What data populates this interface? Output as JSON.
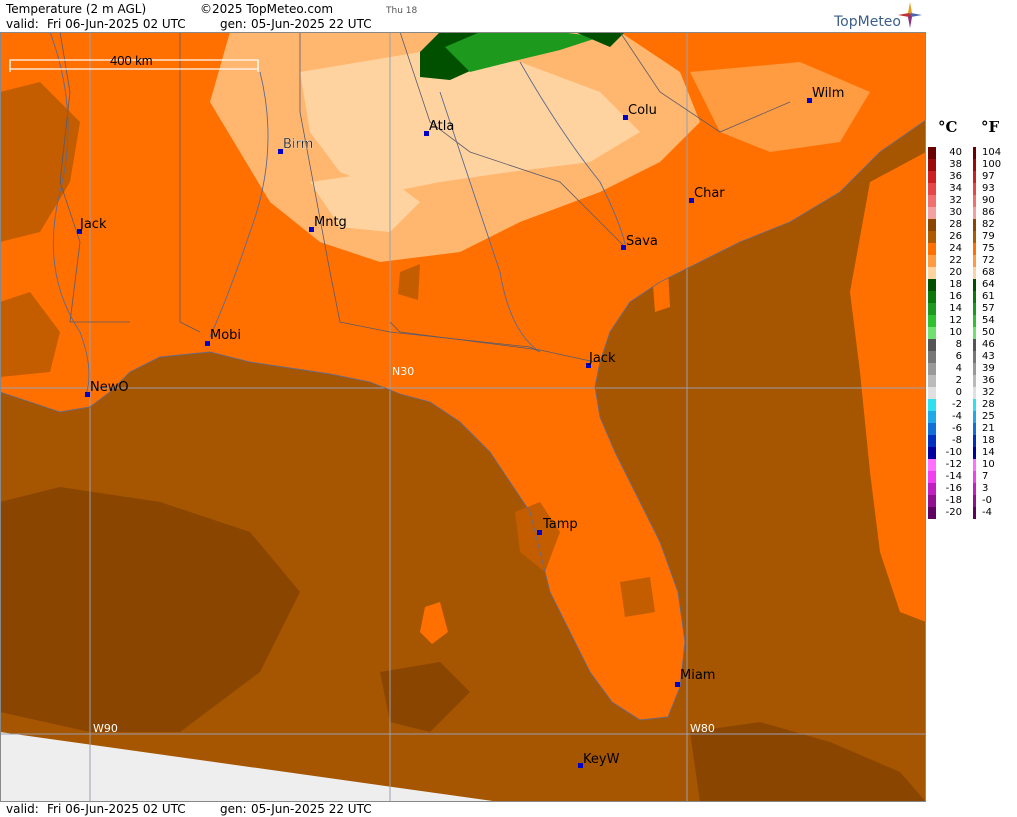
{
  "header": {
    "title": "Temperature (2 m AGL)",
    "copyright": "©2025 TopMeteo.com",
    "valid_label": "valid:",
    "valid_value": "Fri   06-Jun-2025   02 UTC",
    "gen_label": "gen:",
    "gen_value": "05-Jun-2025 22 UTC",
    "day_small": "Thu 18"
  },
  "footer": {
    "valid_label": "valid:",
    "valid_value": "Fri   06-Jun-2025   02 UTC",
    "gen_label": "gen:",
    "gen_value": "05-Jun-2025 22 UTC"
  },
  "logo": {
    "text": "TopMeteo",
    "icon": "compass-star-icon"
  },
  "map": {
    "scale_label": "400 km",
    "grid_labels": {
      "lat": "N30",
      "lon_west": "W90",
      "lon_east": "W80"
    },
    "colors": {
      "sea": "#a65500",
      "land_main": "#ff7000",
      "land_warm_dark": "#c45c00",
      "land_light": "#ffb770",
      "land_pale": "#ffd3a0",
      "green_dark": "#005000",
      "green_mid": "#1d9a1d",
      "sea_dark_patch": "#8a4600",
      "nodata": "#eeeeee",
      "boundary": "#5a5a6a",
      "grid": "#9aa0b0",
      "city_marker": "#0000c8"
    },
    "cities": [
      {
        "name": "Birm"
      },
      {
        "name": "Atla"
      },
      {
        "name": "Colu"
      },
      {
        "name": "Wilm"
      },
      {
        "name": "Jack"
      },
      {
        "name": "Mntg"
      },
      {
        "name": "Char"
      },
      {
        "name": "Sava"
      },
      {
        "name": "Mobi"
      },
      {
        "name": "Jack"
      },
      {
        "name": "NewO"
      },
      {
        "name": "Tamp"
      },
      {
        "name": "Miam"
      },
      {
        "name": "KeyW"
      }
    ]
  },
  "legend": {
    "celsius_unit": "°C",
    "fahrenheit_unit": "°F",
    "entries": [
      {
        "c": "40",
        "f": "104",
        "color": "#6a0000"
      },
      {
        "c": "38",
        "f": "100",
        "color": "#9b0a0a"
      },
      {
        "c": "36",
        "f": "97",
        "color": "#cc2020"
      },
      {
        "c": "34",
        "f": "93",
        "color": "#e64646"
      },
      {
        "c": "32",
        "f": "90",
        "color": "#f07070"
      },
      {
        "c": "30",
        "f": "86",
        "color": "#f5a0a0"
      },
      {
        "c": "28",
        "f": "82",
        "color": "#8a4600"
      },
      {
        "c": "26",
        "f": "79",
        "color": "#b05a00"
      },
      {
        "c": "24",
        "f": "75",
        "color": "#ff7000"
      },
      {
        "c": "22",
        "f": "72",
        "color": "#ff9b40"
      },
      {
        "c": "20",
        "f": "68",
        "color": "#ffd3a0"
      },
      {
        "c": "18",
        "f": "64",
        "color": "#005000"
      },
      {
        "c": "16",
        "f": "61",
        "color": "#0a780a"
      },
      {
        "c": "14",
        "f": "57",
        "color": "#1d9a1d"
      },
      {
        "c": "12",
        "f": "54",
        "color": "#30c030"
      },
      {
        "c": "10",
        "f": "50",
        "color": "#70e070"
      },
      {
        "c": "8",
        "f": "46",
        "color": "#555555"
      },
      {
        "c": "6",
        "f": "43",
        "color": "#777777"
      },
      {
        "c": "4",
        "f": "39",
        "color": "#999999"
      },
      {
        "c": "2",
        "f": "36",
        "color": "#bbbbbb"
      },
      {
        "c": "0",
        "f": "32",
        "color": "#e0e0e0"
      },
      {
        "c": "-2",
        "f": "28",
        "color": "#30e0f0"
      },
      {
        "c": "-4",
        "f": "25",
        "color": "#20a8e8"
      },
      {
        "c": "-6",
        "f": "21",
        "color": "#1070d8"
      },
      {
        "c": "-8",
        "f": "18",
        "color": "#0030c0"
      },
      {
        "c": "-10",
        "f": "14",
        "color": "#0000a0"
      },
      {
        "c": "-12",
        "f": "10",
        "color": "#ff70ff"
      },
      {
        "c": "-14",
        "f": "7",
        "color": "#f040f0"
      },
      {
        "c": "-16",
        "f": "3",
        "color": "#c020c0"
      },
      {
        "c": "-18",
        "f": "-0",
        "color": "#901090"
      },
      {
        "c": "-20",
        "f": "-4",
        "color": "#600060"
      }
    ]
  }
}
